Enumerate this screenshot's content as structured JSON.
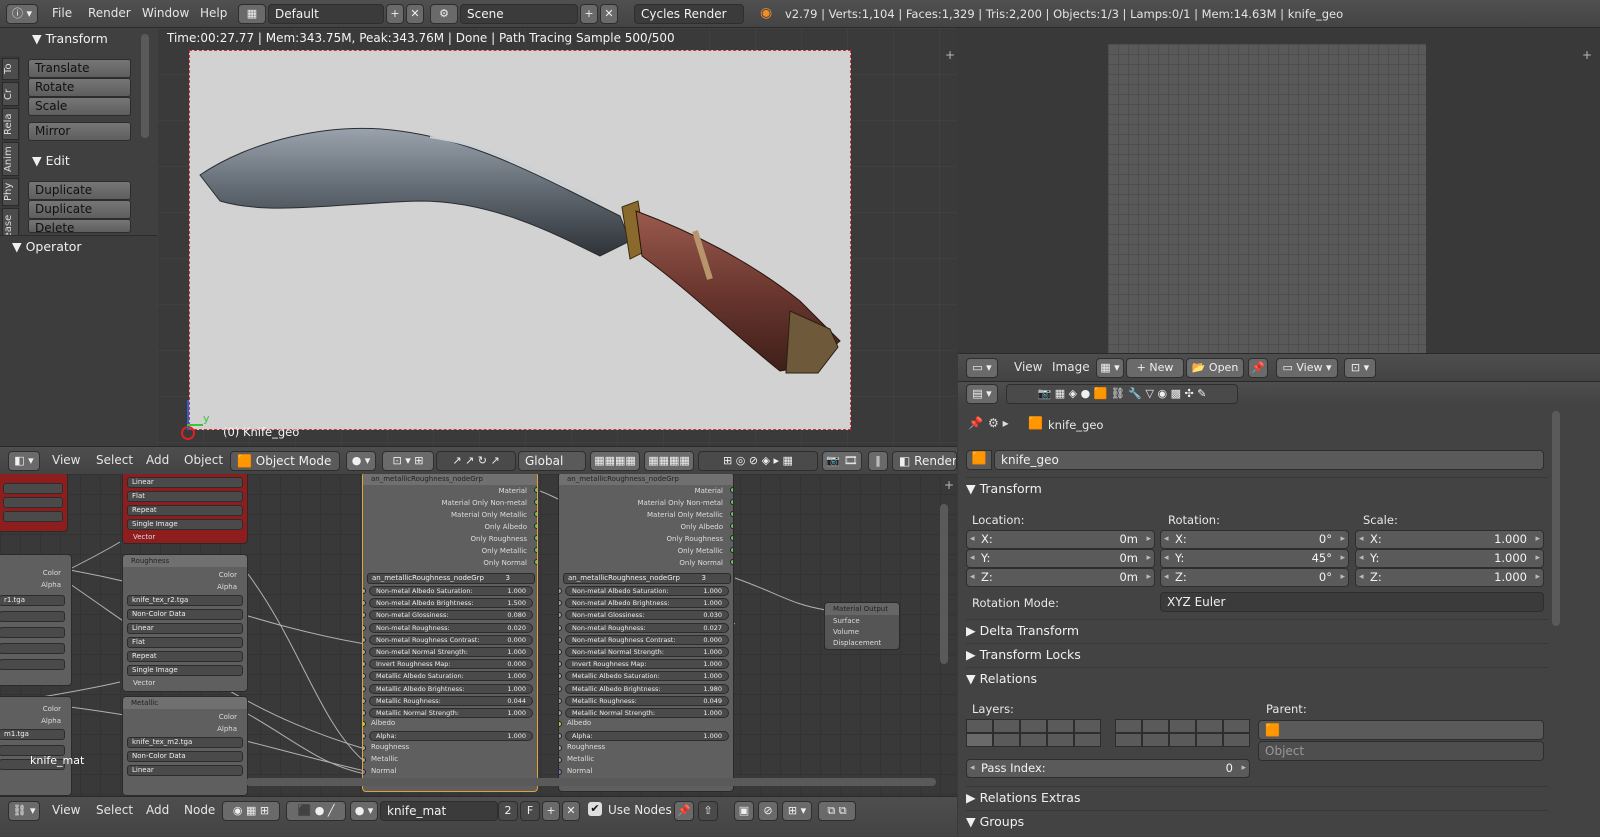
{
  "topbar": {
    "menus": [
      "File",
      "Render",
      "Window",
      "Help"
    ],
    "screen_layout": "Default",
    "scene": "Scene",
    "engine": "Cycles Render",
    "stats": "v2.79 | Verts:1,104 | Faces:1,329 | Tris:2,200 | Objects:1/3 | Lamps:0/1 | Mem:14.63M | knife_geo"
  },
  "toolshelf": {
    "tabs": [
      "To",
      "Cr",
      "Rela",
      "Anim",
      "Phy",
      "Grease"
    ],
    "transform_title": "Transform",
    "transform_buttons": [
      "Translate",
      "Rotate",
      "Scale",
      "Mirror"
    ],
    "edit_title": "Edit",
    "edit_buttons": [
      "Duplicate",
      "Duplicate Linked",
      "Delete"
    ],
    "operator_title": "Operator"
  },
  "viewport": {
    "render_status": "Time:00:27.77 | Mem:343.75M, Peak:343.76M | Done | Path Tracing Sample 500/500",
    "object_label": "(0) Knife_geo",
    "axis_y": "y"
  },
  "view3d_header": {
    "menus": [
      "View",
      "Select",
      "Add",
      "Object"
    ],
    "mode": "Object Mode",
    "orientation": "Global",
    "render_layer": "RenderL"
  },
  "image_editor_header": {
    "menus": [
      "View",
      "Image"
    ],
    "new_label": "New",
    "open_label": "Open",
    "view_label": "View"
  },
  "properties": {
    "breadcrumb": "knife_geo",
    "object_name": "knife_geo",
    "transform_title": "Transform",
    "location_label": "Location:",
    "rotation_label": "Rotation:",
    "scale_label": "Scale:",
    "location": [
      {
        "axis": "X:",
        "value": "0m"
      },
      {
        "axis": "Y:",
        "value": "0m"
      },
      {
        "axis": "Z:",
        "value": "0m"
      }
    ],
    "rotation": [
      {
        "axis": "X:",
        "value": "0°"
      },
      {
        "axis": "Y:",
        "value": "45°"
      },
      {
        "axis": "Z:",
        "value": "0°"
      }
    ],
    "scale": [
      {
        "axis": "X:",
        "value": "1.000"
      },
      {
        "axis": "Y:",
        "value": "1.000"
      },
      {
        "axis": "Z:",
        "value": "1.000"
      }
    ],
    "rotation_mode_label": "Rotation Mode:",
    "rotation_mode": "XYZ Euler",
    "delta_transform": "Delta Transform",
    "transform_locks": "Transform Locks",
    "relations": "Relations",
    "layers_label": "Layers:",
    "parent_label": "Parent:",
    "parent_type": "Object",
    "pass_index_label": "Pass Index:",
    "pass_index": "0",
    "relations_extras": "Relations Extras",
    "groups": "Groups"
  },
  "node_editor_header": {
    "menus": [
      "View",
      "Select",
      "Add",
      "Node"
    ],
    "material": "knife_mat",
    "users": "2",
    "fake_user": "F",
    "use_nodes": "Use Nodes"
  },
  "node_editor": {
    "material_label": "knife_mat",
    "tex_nodes": [
      {
        "title": "Roughness",
        "image": "knife_tex_r2.tga",
        "colorspace": "Non-Color Data",
        "interp": "Linear",
        "proj": "Flat",
        "ext": "Repeat",
        "source": "Single Image"
      },
      {
        "title": "Metallic",
        "image": "knife_tex_m2.tga",
        "colorspace": "Non-Color Data",
        "interp": "Linear"
      }
    ],
    "red_node": {
      "interp": "Linear",
      "proj": "Flat",
      "ext": "Repeat",
      "source": "Single Image",
      "vector": "Vector"
    },
    "left_partial": {
      "color": "Color",
      "alpha": "Alpha",
      "file1": "r1.tga",
      "file2": "m1.tga"
    },
    "group_nodes": [
      {
        "title": "an_metallicRoughness_nodeGrp",
        "group": "an_metallicRoughness_nodeGrp",
        "users": "3",
        "outputs": [
          "Material",
          "Material Only Non-metal",
          "Material Only Metallic",
          "Only Albedo",
          "Only Roughness",
          "Only Metallic",
          "Only Normal"
        ],
        "params": [
          {
            "n": "Non-metal Albedo Saturation:",
            "v": "1.000"
          },
          {
            "n": "Non-metal Albedo Brightness:",
            "v": "1.500"
          },
          {
            "n": "Non-metal Glossiness:",
            "v": "0.080"
          },
          {
            "n": "Non-metal Roughness:",
            "v": "0.020"
          },
          {
            "n": "Non-metal Roughness Contrast:",
            "v": "0.000"
          },
          {
            "n": "Non-metal Normal Strength:",
            "v": "1.000"
          },
          {
            "n": "Invert Roughness Map:",
            "v": "0.000"
          },
          {
            "n": "Metallic Albedo Saturation:",
            "v": "1.000"
          },
          {
            "n": "Metallic Albedo Brightness:",
            "v": "1.000"
          },
          {
            "n": "Metallic Roughness:",
            "v": "0.044"
          },
          {
            "n": "Metallic Normal Strength:",
            "v": "1.000"
          }
        ],
        "inputs": [
          "Albedo",
          "Alpha:",
          "Roughness",
          "Metallic",
          "Normal"
        ],
        "alpha": "1.000"
      },
      {
        "title": "an_metallicRoughness_nodeGrp",
        "group": "an_metallicRoughness_nodeGrp",
        "users": "3",
        "outputs": [
          "Material",
          "Material Only Non-metal",
          "Material Only Metallic",
          "Only Albedo",
          "Only Roughness",
          "Only Metallic",
          "Only Normal"
        ],
        "params": [
          {
            "n": "Non-metal Albedo Saturation:",
            "v": "1.000"
          },
          {
            "n": "Non-metal Albedo Brightness:",
            "v": "1.000"
          },
          {
            "n": "Non-metal Glossiness:",
            "v": "0.030"
          },
          {
            "n": "Non-metal Roughness:",
            "v": "0.027"
          },
          {
            "n": "Non-metal Roughness Contrast:",
            "v": "0.000"
          },
          {
            "n": "Non-metal Normal Strength:",
            "v": "1.000"
          },
          {
            "n": "Invert Roughness Map:",
            "v": "1.000"
          },
          {
            "n": "Metallic Albedo Saturation:",
            "v": "1.000"
          },
          {
            "n": "Metallic Albedo Brightness:",
            "v": "1.980"
          },
          {
            "n": "Metallic Roughness:",
            "v": "0.049"
          },
          {
            "n": "Metallic Normal Strength:",
            "v": "1.000"
          }
        ],
        "inputs": [
          "Albedo",
          "Alpha:",
          "Roughness",
          "Metallic",
          "Normal"
        ],
        "alpha": "1.000"
      }
    ],
    "output_node": {
      "title": "Material Output",
      "inputs": [
        "Surface",
        "Volume",
        "Displacement"
      ]
    }
  }
}
